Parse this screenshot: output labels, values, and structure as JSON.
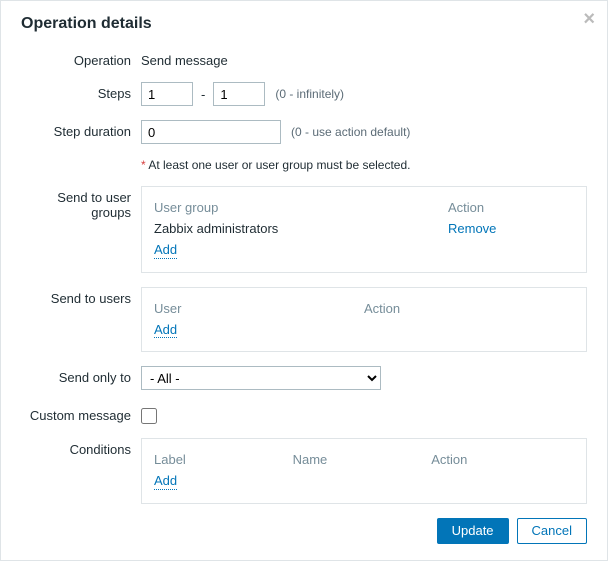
{
  "modal": {
    "title": "Operation details",
    "close_label": "×"
  },
  "labels": {
    "operation": "Operation",
    "steps": "Steps",
    "step_duration": "Step duration",
    "send_to_user_groups": "Send to user groups",
    "send_to_users": "Send to users",
    "send_only_to": "Send only to",
    "custom_message": "Custom message",
    "conditions": "Conditions"
  },
  "operation": {
    "value": "Send message"
  },
  "steps": {
    "from": "1",
    "to": "1",
    "hint": "(0 - infinitely)"
  },
  "step_duration": {
    "value": "0",
    "hint": "(0 - use action default)"
  },
  "required_note": {
    "marker": "*",
    "text": " At least one user or user group must be selected."
  },
  "user_groups": {
    "columns": {
      "group": "User group",
      "action": "Action"
    },
    "rows": [
      {
        "name": "Zabbix administrators",
        "action_label": "Remove"
      }
    ],
    "add_label": "Add"
  },
  "users": {
    "columns": {
      "user": "User",
      "action": "Action"
    },
    "add_label": "Add"
  },
  "send_only_to": {
    "selected": "- All -"
  },
  "custom_message": {
    "checked": false
  },
  "conditions": {
    "columns": {
      "label": "Label",
      "name": "Name",
      "action": "Action"
    },
    "add_label": "Add"
  },
  "footer": {
    "update": "Update",
    "cancel": "Cancel"
  }
}
